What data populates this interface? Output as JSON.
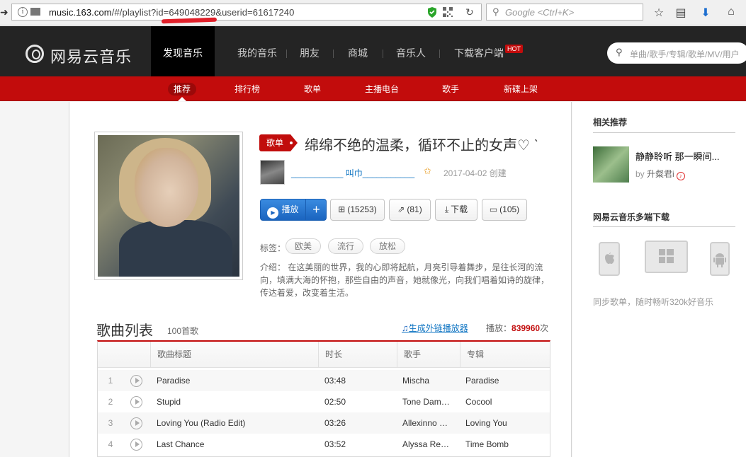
{
  "browser": {
    "url_host": "music.163.com",
    "url_path": "/#/playlist?id=649048229&userid=61617240",
    "search_placeholder": "Google <Ctrl+K>"
  },
  "site": {
    "logo_text": "网易云音乐",
    "nav": [
      {
        "label": "发现音乐",
        "active": true
      },
      {
        "label": "我的音乐"
      },
      {
        "label": "朋友"
      },
      {
        "label": "商城"
      },
      {
        "label": "音乐人"
      },
      {
        "label": "下载客户端"
      }
    ],
    "hot_badge": "HOT",
    "search_placeholder": "单曲/歌手/专辑/歌单/MV/用户",
    "subnav": [
      {
        "label": "推荐",
        "active": true
      },
      {
        "label": "排行榜"
      },
      {
        "label": "歌单"
      },
      {
        "label": "主播电台"
      },
      {
        "label": "歌手"
      },
      {
        "label": "新碟上架"
      }
    ]
  },
  "playlist": {
    "tag": "歌单",
    "title": "绵绵不绝的温柔，循环不止的女声♡ ˋ",
    "creator": "___________ 叫巾___________",
    "created": "2017-04-02 创建",
    "buttons": {
      "play": "播放",
      "add": "+",
      "collect": "(15253)",
      "share": "(81)",
      "download": "下载",
      "comment": "(105)"
    },
    "tags_label": "标签：",
    "tags": [
      "欧美",
      "流行",
      "放松"
    ],
    "description": "介绍：  在这美丽的世界，我的心即将起航，月亮引导着舞步，是往长河的流向，填满大海的怀抱，那些自由的声音，她就像光，向我们唱着如诗的旋律，传达着爱，改变着生活。"
  },
  "tracklist": {
    "title": "歌曲列表",
    "count": "100首歌",
    "outchain": "生成外链播放器",
    "play_label": "播放：",
    "play_count": "839960",
    "play_unit": "次",
    "headers": [
      "歌曲标题",
      "时长",
      "歌手",
      "专辑"
    ],
    "tracks": [
      {
        "no": "1",
        "title": "Paradise",
        "duration": "03:48",
        "artist": "Mischa",
        "album": "Paradise"
      },
      {
        "no": "2",
        "title": "Stupid",
        "duration": "02:50",
        "artist": "Tone Dam…",
        "album": "Cocool"
      },
      {
        "no": "3",
        "title": "Loving You (Radio Edit)",
        "duration": "03:26",
        "artist": "Allexinno …",
        "album": "Loving You"
      },
      {
        "no": "4",
        "title": "Last Chance",
        "duration": "03:52",
        "artist": "Alyssa Re…",
        "album": "Time Bomb"
      }
    ]
  },
  "sidebar": {
    "related_title": "相关推荐",
    "related": {
      "name": "静静聆听 那一瞬间...",
      "by": "by",
      "nick": "升粲君i"
    },
    "download_title": "网易云音乐多端下载",
    "download_note": "同步歌单，随时畅听320k好音乐"
  },
  "colors": {
    "brand_red": "#c20c0c",
    "link_blue": "#0c73c2",
    "header_dark": "#242424"
  }
}
